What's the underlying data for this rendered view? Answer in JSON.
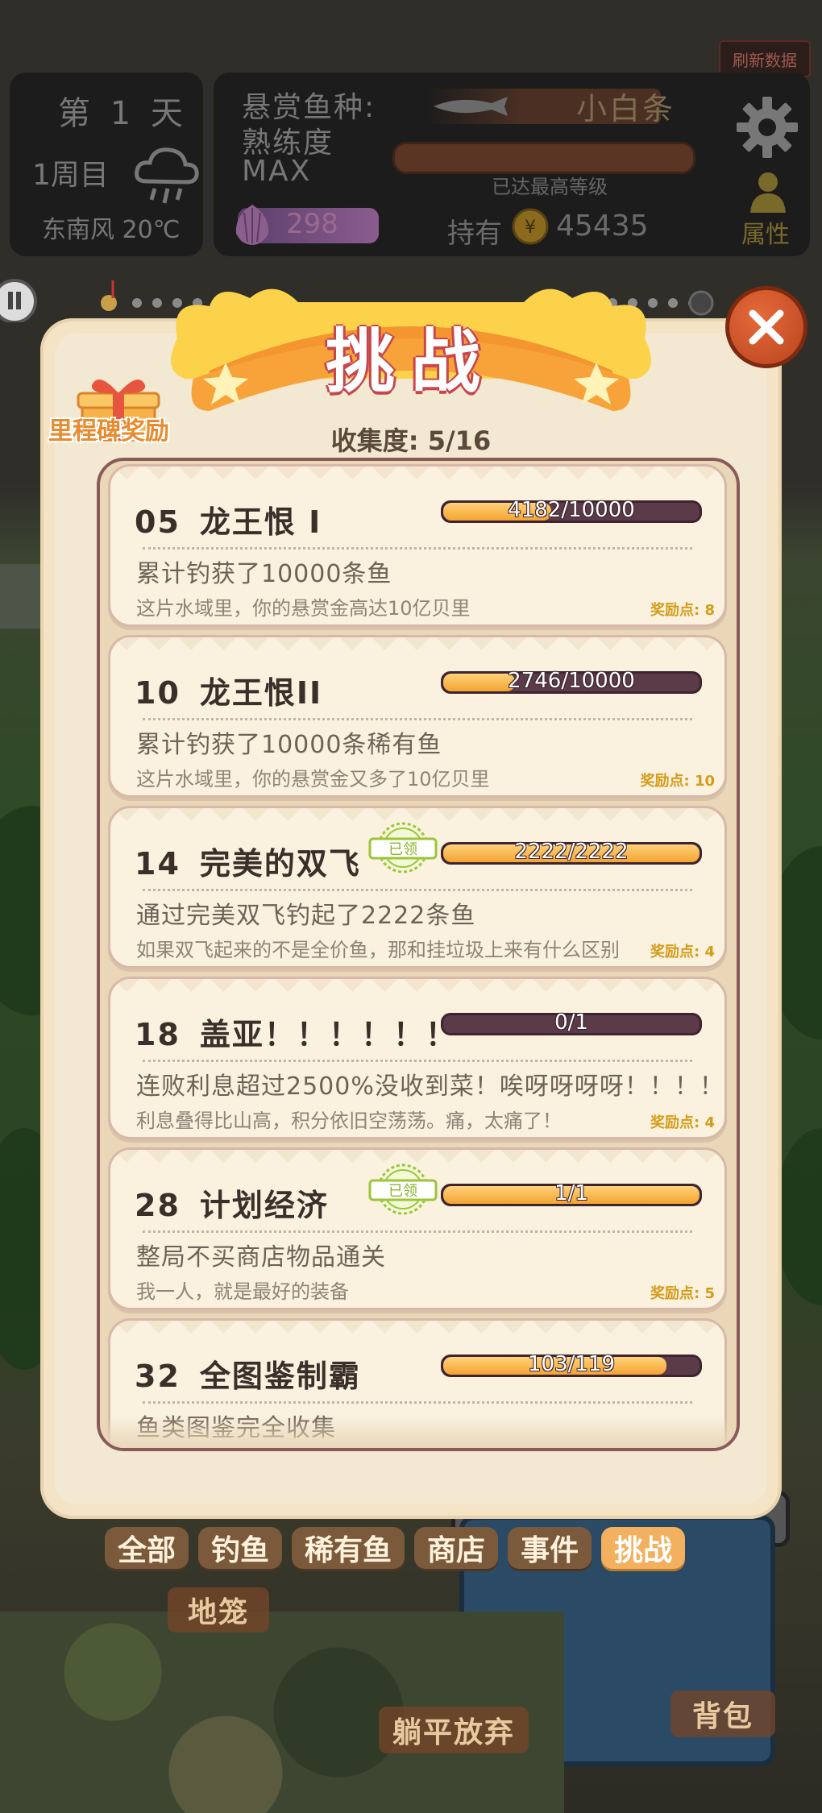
{
  "hud": {
    "refresh_label": "刷新数据",
    "day_label": "第 1 天",
    "cycle_label": "1周目",
    "weather_icon": "rain-cloud-icon",
    "wind_temp": "东南风 20℃",
    "bounty_label": "悬赏鱼种:",
    "bounty_fish": "小白条",
    "mastery_label": "熟练度",
    "mastery_level": "MAX",
    "mastery_status": "已达最高等级",
    "shell_value": "298",
    "hold_label": "持有",
    "coin_value": "45435",
    "attr_label": "属性"
  },
  "modal": {
    "title": "挑战",
    "milestone_label": "里程碑奖励",
    "collection_label": "收集度:  5/16"
  },
  "stamp_text": "已领",
  "challenges": [
    {
      "num": "05",
      "name": "龙王恨 I",
      "progress_text": "4182/10000",
      "progress": 0.418,
      "desc": "累计钓获了10000条鱼",
      "flavor": "这片水域里，你的悬赏金高达10亿贝里",
      "points": "奖励点: 8",
      "claimed": false
    },
    {
      "num": "10",
      "name": "龙王恨II",
      "progress_text": "2746/10000",
      "progress": 0.275,
      "desc": "累计钓获了10000条稀有鱼",
      "flavor": "这片水域里，你的悬赏金又多了10亿贝里",
      "points": "奖励点: 10",
      "claimed": false
    },
    {
      "num": "14",
      "name": "完美的双飞",
      "progress_text": "2222/2222",
      "progress": 1.0,
      "desc": "通过完美双飞钓起了2222条鱼",
      "flavor": "如果双飞起来的不是全价鱼，那和挂垃圾上来有什么区别",
      "points": "奖励点: 4",
      "claimed": true
    },
    {
      "num": "18",
      "name": "盖亚！！！！！！",
      "progress_text": "0/1",
      "progress": 0.0,
      "desc": "连败利息超过2500%没收到菜！唉呀呀呀呀！！！！！！！",
      "flavor": "利息叠得比山高，积分依旧空荡荡。痛，太痛了！",
      "points": "奖励点: 4",
      "claimed": false
    },
    {
      "num": "28",
      "name": "计划经济",
      "progress_text": "1/1",
      "progress": 1.0,
      "desc": "整局不买商店物品通关",
      "flavor": "我一人，就是最好的装备",
      "points": "奖励点: 5",
      "claimed": true
    },
    {
      "num": "32",
      "name": "全图鉴制霸",
      "progress_text": "103/119",
      "progress": 0.866,
      "desc": "鱼类图鉴完全收集",
      "flavor": "",
      "points": "",
      "claimed": false
    }
  ],
  "tabs": [
    {
      "label": "全部",
      "active": false
    },
    {
      "label": "钓鱼",
      "active": false
    },
    {
      "label": "稀有鱼",
      "active": false
    },
    {
      "label": "商店",
      "active": false
    },
    {
      "label": "事件",
      "active": false
    },
    {
      "label": "挑战",
      "active": true
    }
  ],
  "scene": {
    "cage_label": "地笼",
    "giveup_label": "躺平放弃",
    "bag_label": "背包"
  },
  "colors": {
    "accent": "#f3b05e",
    "title_outline": "#c7464d",
    "close": "#d95a2b",
    "points": "#d49c18"
  }
}
